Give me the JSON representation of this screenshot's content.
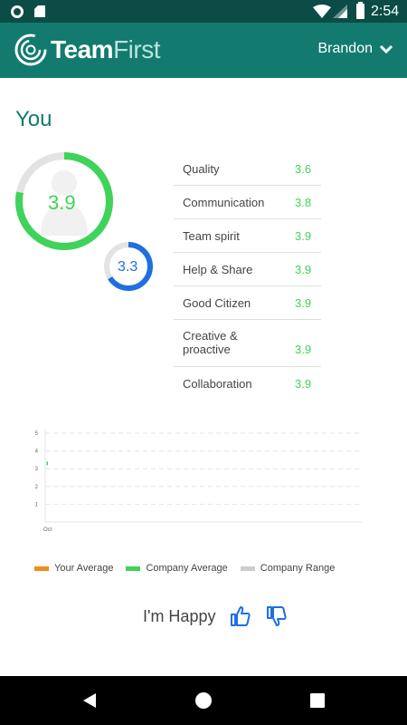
{
  "status_bar": {
    "time": "2:54",
    "icons": [
      "notification-circle-icon",
      "sd-card-icon",
      "wifi-icon",
      "cell-signal-icon",
      "battery-icon"
    ]
  },
  "app_bar": {
    "brand_bold": "Team",
    "brand_light": "First",
    "user_name": "Brandon",
    "menu_icon": "chevron-down-icon"
  },
  "section": {
    "title": "You"
  },
  "scores": {
    "overall": "3.9",
    "overall_fraction": 0.78,
    "secondary": "3.3",
    "secondary_fraction": 0.66,
    "colors": {
      "overall": "#3fd35a",
      "secondary": "#1f6fe0",
      "track": "#e3e3e3"
    }
  },
  "metrics": [
    {
      "label": "Quality",
      "value": "3.6"
    },
    {
      "label": "Communication",
      "value": "3.8"
    },
    {
      "label": "Team spirit",
      "value": "3.9"
    },
    {
      "label": "Help & Share",
      "value": "3.9"
    },
    {
      "label": "Good Citizen",
      "value": "3.9"
    },
    {
      "label": "Creative & proactive",
      "value": "3.9"
    },
    {
      "label": "Collaboration",
      "value": "3.9"
    }
  ],
  "chart_data": {
    "type": "line",
    "categories": [
      "Oct"
    ],
    "series": [
      {
        "name": "Your Average",
        "values": [],
        "color": "#f28c1a"
      },
      {
        "name": "Company Average",
        "values": [
          3.3
        ],
        "color": "#3fd35a"
      },
      {
        "name": "Company Range",
        "values": [],
        "color": "#cccccc"
      }
    ],
    "y_ticks": [
      "1",
      "2",
      "3",
      "4",
      "5"
    ],
    "ylim": [
      0,
      5
    ],
    "grid": true,
    "legend_position": "bottom"
  },
  "legend": {
    "your_average": "Your Average",
    "company_average": "Company Average",
    "company_range": "Company Range"
  },
  "feedback": {
    "text": "I'm Happy",
    "thumbs_up_icon": "thumbs-up-icon",
    "thumbs_down_icon": "thumbs-down-icon"
  },
  "nav_bar": {
    "icons": [
      "back-icon",
      "home-icon",
      "recents-icon"
    ]
  }
}
